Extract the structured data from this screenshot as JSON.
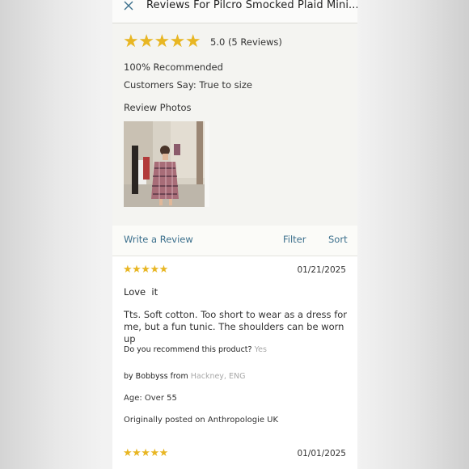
{
  "header": {
    "title": "Reviews For Pilcro Smocked Plaid Mini..."
  },
  "summary": {
    "stars": "★★★★★",
    "rating_text": "5.0 (5 Reviews)",
    "recommended": "100% Recommended",
    "customers_say": "Customers Say: True to size",
    "photos_label": "Review Photos"
  },
  "actions": {
    "write_review": "Write a Review",
    "filter": "Filter",
    "sort": "Sort"
  },
  "reviews": [
    {
      "stars": "★★★★★",
      "date": "01/21/2025",
      "title": "Love  it",
      "body": "Tts. Soft cotton. Too short to wear as a dress for me, but a fun tunic. The shoulders can be worn up",
      "recommend_question": "Do you recommend this product?",
      "recommend_answer": "Yes",
      "by_prefix": "by Bobbyss from",
      "location": "Hackney, ENG",
      "age": "Age: Over 55",
      "origin": "Originally posted on Anthropologie UK"
    },
    {
      "stars": "★★★★★",
      "date": "01/01/2025"
    }
  ],
  "colors": {
    "star": "#e8b623",
    "link": "#3b6f8c",
    "muted": "#a8a8a8"
  }
}
